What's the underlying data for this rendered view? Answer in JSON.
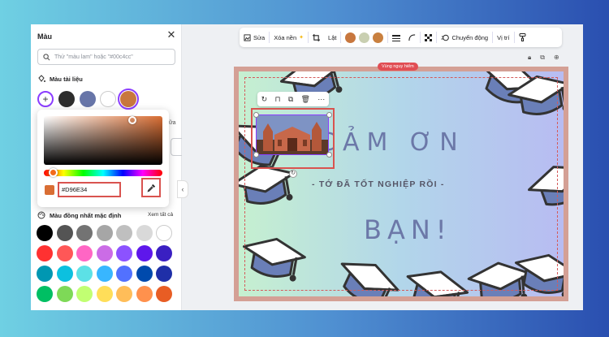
{
  "panel": {
    "title": "Màu",
    "search_placeholder": "Thử \"màu lam\" hoặc \"#00c4cc\"",
    "doc_colors_title": "Màu tài liệu",
    "doc_colors": [
      "#2d2d2d",
      "#6775a8",
      "#ffffff",
      "#c8773e"
    ],
    "picker": {
      "hex_value": "#D96E34",
      "current_color": "#d96e34"
    },
    "partial_label": "ữa",
    "default_colors_title": "Màu đồng nhất mặc định",
    "see_all": "Xem tất cả",
    "default_colors": [
      "#000000",
      "#545454",
      "#737373",
      "#a6a6a6",
      "#bfbfbf",
      "#d9d9d9",
      "#ffffff",
      "#ff3131",
      "#ff5757",
      "#ff66c4",
      "#cb6ce6",
      "#8c52ff",
      "#5e17eb",
      "#3a1fc2",
      "#0097b2",
      "#0cc0df",
      "#5ce1e6",
      "#38b6ff",
      "#5271ff",
      "#004aad",
      "#1f2fa8",
      "#00bf63",
      "#7ed957",
      "#c1ff72",
      "#ffde59",
      "#ffbd59",
      "#ff914d",
      "#e85d24"
    ]
  },
  "toolbar": {
    "edit": "Sửa",
    "bg_remove": "Xóa nền",
    "flip": "Lật",
    "color_dots": [
      "#c8773e",
      "#c9cfb1",
      "#c9803f"
    ],
    "animate": "Chuyển động",
    "position": "Vị trí"
  },
  "canvas": {
    "danger_zone": "Vùng nguy hiểm",
    "title_line1": "CẢM ƠN",
    "subtitle": "- TỚ ĐÃ TỐT NGHIỆP RỒI -",
    "title_line2": "BẠN!"
  }
}
